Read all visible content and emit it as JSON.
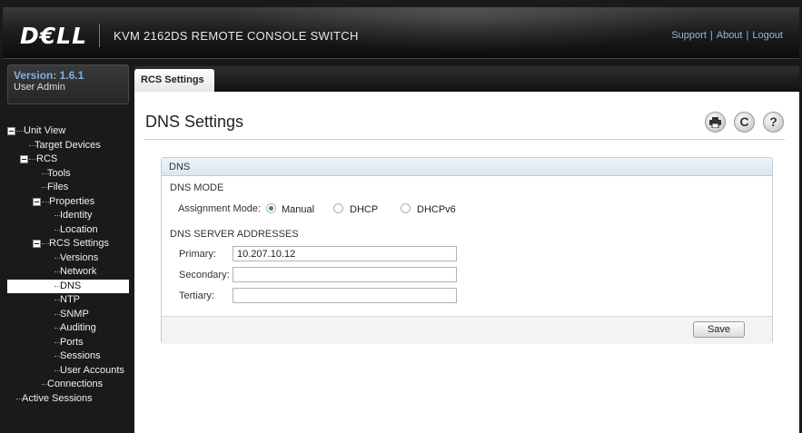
{
  "header": {
    "logo": "D€LL",
    "product_title": "KVM 2162DS REMOTE CONSOLE SWITCH",
    "links": {
      "support": "Support",
      "about": "About",
      "logout": "Logout",
      "separator": "|"
    }
  },
  "sidebar": {
    "version": "Version: 1.6.1",
    "user": "User Admin",
    "tree": [
      {
        "label": "Unit View",
        "level": 0,
        "toggle": true,
        "selected": false
      },
      {
        "label": "Target Devices",
        "level": 1,
        "toggle": false,
        "selected": false
      },
      {
        "label": "RCS",
        "level": 1,
        "toggle": true,
        "selected": false
      },
      {
        "label": "Tools",
        "level": 2,
        "toggle": false,
        "selected": false
      },
      {
        "label": "Files",
        "level": 2,
        "toggle": false,
        "selected": false
      },
      {
        "label": "Properties",
        "level": 2,
        "toggle": true,
        "selected": false
      },
      {
        "label": "Identity",
        "level": 3,
        "toggle": false,
        "selected": false
      },
      {
        "label": "Location",
        "level": 3,
        "toggle": false,
        "selected": false
      },
      {
        "label": "RCS Settings",
        "level": 2,
        "toggle": true,
        "selected": false
      },
      {
        "label": "Versions",
        "level": 3,
        "toggle": false,
        "selected": false
      },
      {
        "label": "Network",
        "level": 3,
        "toggle": false,
        "selected": false
      },
      {
        "label": "DNS",
        "level": 3,
        "toggle": false,
        "selected": true
      },
      {
        "label": "NTP",
        "level": 3,
        "toggle": false,
        "selected": false
      },
      {
        "label": "SNMP",
        "level": 3,
        "toggle": false,
        "selected": false
      },
      {
        "label": "Auditing",
        "level": 3,
        "toggle": false,
        "selected": false
      },
      {
        "label": "Ports",
        "level": 3,
        "toggle": false,
        "selected": false
      },
      {
        "label": "Sessions",
        "level": 3,
        "toggle": false,
        "selected": false
      },
      {
        "label": "User Accounts",
        "level": 3,
        "toggle": false,
        "selected": false
      },
      {
        "label": "Connections",
        "level": 2,
        "toggle": false,
        "selected": false
      },
      {
        "label": "Active Sessions",
        "level": 0,
        "toggle": false,
        "selected": false
      }
    ]
  },
  "tabs": [
    {
      "label": "RCS Settings",
      "active": true
    }
  ],
  "page": {
    "title": "DNS Settings",
    "icons": {
      "print": "printer-icon",
      "refresh": "refresh-icon",
      "help": "help-icon"
    }
  },
  "panel": {
    "header": "DNS",
    "mode_section": "DNS MODE",
    "assignment_label": "Assignment Mode:",
    "modes": [
      {
        "label": "Manual",
        "checked": true
      },
      {
        "label": "DHCP",
        "checked": false
      },
      {
        "label": "DHCPv6",
        "checked": false
      }
    ],
    "servers_section": "DNS SERVER ADDRESSES",
    "fields": [
      {
        "label": "Primary:",
        "value": "10.207.10.12"
      },
      {
        "label": "Secondary:",
        "value": ""
      },
      {
        "label": "Tertiary:",
        "value": ""
      }
    ],
    "save_label": "Save"
  },
  "colors": {
    "accent": "#7fb2e5",
    "radio_checked": "#3c8f3c",
    "header_bg": "#1e1e1e"
  }
}
